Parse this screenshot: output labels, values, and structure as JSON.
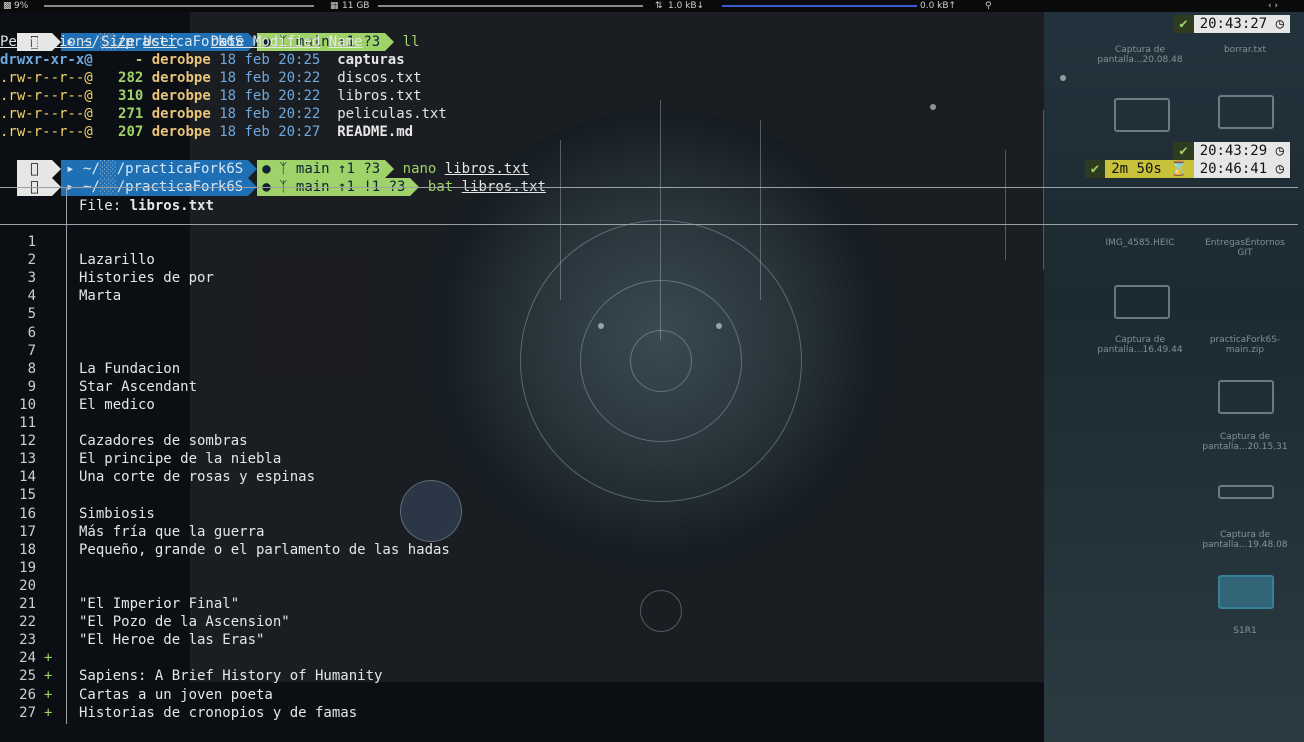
{
  "status_bar": {
    "cpu": "9%",
    "memory": "11 GB",
    "net_down": "1.0 kB↓",
    "net_up": "0.0 kB↑"
  },
  "prompt": {
    "path_prefix": "~/",
    "path_mid": "/",
    "dir": "practicaFork6S",
    "branch": "main",
    "git_status_1": "↑1 ?3",
    "git_status_3": "↑1 !1 ?3"
  },
  "commands": {
    "cmd1": "ll",
    "cmd2": "nano",
    "cmd2_arg": "libros.txt",
    "cmd3": "bat",
    "cmd3_arg": "libros.txt"
  },
  "right_prompts": {
    "time1": "20:43:27",
    "time2": "20:43:29",
    "duration3": "2m 50s",
    "time3": "20:46:41"
  },
  "listing": {
    "headers": [
      "Permissions",
      "Size",
      "User",
      "Date Modified",
      "Name"
    ],
    "rows": [
      {
        "perm": "drwxr-xr-x@",
        "size": "-",
        "user": "derobpe",
        "date": "18 feb 20:25",
        "name": "capturas"
      },
      {
        "perm": ".rw-r--r--@",
        "size": "282",
        "user": "derobpe",
        "date": "18 feb 20:22",
        "name": "discos.txt"
      },
      {
        "perm": ".rw-r--r--@",
        "size": "310",
        "user": "derobpe",
        "date": "18 feb 20:22",
        "name": "libros.txt"
      },
      {
        "perm": ".rw-r--r--@",
        "size": "271",
        "user": "derobpe",
        "date": "18 feb 20:22",
        "name": "peliculas.txt"
      },
      {
        "perm": ".rw-r--r--@",
        "size": "207",
        "user": "derobpe",
        "date": "18 feb 20:27",
        "name": "README.md"
      }
    ]
  },
  "bat": {
    "file_label": "File:",
    "file_name": "libros.txt",
    "lines": [
      {
        "n": "1",
        "mark": "",
        "text": ""
      },
      {
        "n": "2",
        "mark": "",
        "text": "Lazarillo"
      },
      {
        "n": "3",
        "mark": "",
        "text": "Histories de por"
      },
      {
        "n": "4",
        "mark": "",
        "text": "Marta"
      },
      {
        "n": "5",
        "mark": "",
        "text": ""
      },
      {
        "n": "6",
        "mark": "",
        "text": ""
      },
      {
        "n": "7",
        "mark": "",
        "text": ""
      },
      {
        "n": "8",
        "mark": "",
        "text": "La Fundacion"
      },
      {
        "n": "9",
        "mark": "",
        "text": "Star Ascendant"
      },
      {
        "n": "10",
        "mark": "",
        "text": "El medico"
      },
      {
        "n": "11",
        "mark": "",
        "text": ""
      },
      {
        "n": "12",
        "mark": "",
        "text": "Cazadores de sombras"
      },
      {
        "n": "13",
        "mark": "",
        "text": "El principe de la niebla"
      },
      {
        "n": "14",
        "mark": "",
        "text": "Una corte de rosas y espinas"
      },
      {
        "n": "15",
        "mark": "",
        "text": ""
      },
      {
        "n": "16",
        "mark": "",
        "text": "Simbiosis"
      },
      {
        "n": "17",
        "mark": "",
        "text": "Más fría que la guerra"
      },
      {
        "n": "18",
        "mark": "",
        "text": "Pequeño, grande o el parlamento de las hadas"
      },
      {
        "n": "19",
        "mark": "",
        "text": ""
      },
      {
        "n": "20",
        "mark": "",
        "text": ""
      },
      {
        "n": "21",
        "mark": "",
        "text": "\"El Imperior Final\""
      },
      {
        "n": "22",
        "mark": "",
        "text": "\"El Pozo de la Ascension\""
      },
      {
        "n": "23",
        "mark": "",
        "text": "\"El Heroe de las Eras\""
      },
      {
        "n": "24",
        "mark": "+",
        "text": ""
      },
      {
        "n": "25",
        "mark": "+",
        "text": "Sapiens: A Brief History of Humanity"
      },
      {
        "n": "26",
        "mark": "+",
        "text": "Cartas a un joven poeta"
      },
      {
        "n": "27",
        "mark": "+",
        "text": "Historias de cronopios y de famas"
      }
    ]
  },
  "desktop": {
    "labels": [
      "Captura de pantalla...20.08.48",
      "borrar.txt",
      "IMG_4585.HEIC",
      "EntregasEntornos GIT",
      "Captura de pantalla...16.49.44",
      "practicaFork6S-main.zip",
      "Captura de pantalla...20.15.31",
      "Captura de pantalla...19.48.08",
      "S1R1"
    ]
  },
  "colors": {
    "path_bg": "#1f6fb5",
    "git_bg": "#9fd36a",
    "accent_green": "#9fd36a",
    "date_blue": "#6fa8dc"
  }
}
